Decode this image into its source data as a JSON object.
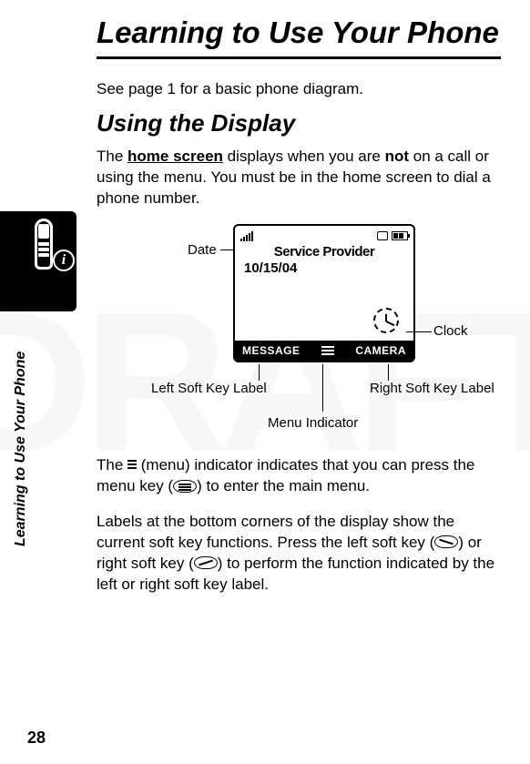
{
  "page_number": "28",
  "side_label": "Learning to Use Your Phone",
  "title": "Learning to Use Your Phone",
  "intro": "See page 1 for a basic phone diagram.",
  "section_heading": "Using the Display",
  "para1_a": "The ",
  "para1_b": "home screen",
  "para1_c": " displays when you are ",
  "para1_d": "not",
  "para1_e": " on a call or using the menu. You must be in the home screen to dial a phone number.",
  "screen": {
    "provider": "Service Provider",
    "date": "10/15/04",
    "left_soft": "MESSAGE",
    "right_soft": "CAMERA"
  },
  "callouts": {
    "date": "Date",
    "clock": "Clock",
    "left": "Left Soft Key Label",
    "right": "Right Soft Key Label",
    "menu": "Menu Indicator"
  },
  "para2_a": "The ",
  "para2_b": " (menu) indicator indicates that you can press the menu key (",
  "para2_c": ") to enter the main menu.",
  "para3_a": "Labels at the bottom corners of the display show the current soft key functions. Press the left soft key (",
  "para3_b": ") or right soft key (",
  "para3_c": ") to perform the function indicated by the left or right soft key label."
}
